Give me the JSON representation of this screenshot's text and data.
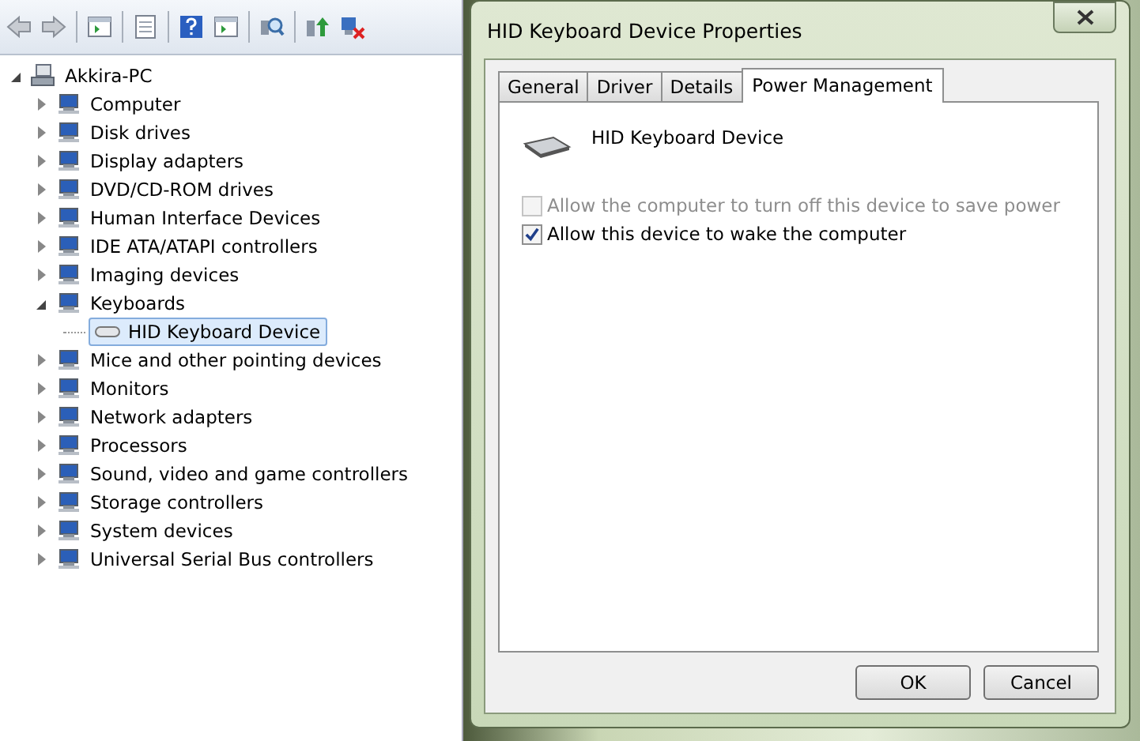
{
  "tree": {
    "label": "Akkira-PC",
    "expanded": true,
    "children": [
      {
        "label": "Computer",
        "expanded": false
      },
      {
        "label": "Disk drives",
        "expanded": false
      },
      {
        "label": "Display adapters",
        "expanded": false
      },
      {
        "label": "DVD/CD-ROM drives",
        "expanded": false
      },
      {
        "label": "Human Interface Devices",
        "expanded": false
      },
      {
        "label": "IDE ATA/ATAPI controllers",
        "expanded": false
      },
      {
        "label": "Imaging devices",
        "expanded": false
      },
      {
        "label": "Keyboards",
        "expanded": true,
        "children": [
          {
            "label": "HID Keyboard Device",
            "selected": true
          }
        ]
      },
      {
        "label": "Mice and other pointing devices",
        "expanded": false
      },
      {
        "label": "Monitors",
        "expanded": false
      },
      {
        "label": "Network adapters",
        "expanded": false
      },
      {
        "label": "Processors",
        "expanded": false
      },
      {
        "label": "Sound, video and game controllers",
        "expanded": false
      },
      {
        "label": "Storage controllers",
        "expanded": false
      },
      {
        "label": "System devices",
        "expanded": false
      },
      {
        "label": "Universal Serial Bus controllers",
        "expanded": false
      }
    ]
  },
  "dialog": {
    "title": "HID Keyboard Device Properties",
    "tabs": [
      {
        "label": "General",
        "selected": false
      },
      {
        "label": "Driver",
        "selected": false
      },
      {
        "label": "Details",
        "selected": false
      },
      {
        "label": "Power Management",
        "selected": true
      }
    ],
    "device_name": "HID Keyboard Device",
    "options": [
      {
        "label": "Allow the computer to turn off this device to save power",
        "checked": false,
        "disabled": true
      },
      {
        "label": "Allow this device to wake the computer",
        "checked": true,
        "disabled": false
      }
    ],
    "buttons": [
      "OK",
      "Cancel"
    ]
  }
}
